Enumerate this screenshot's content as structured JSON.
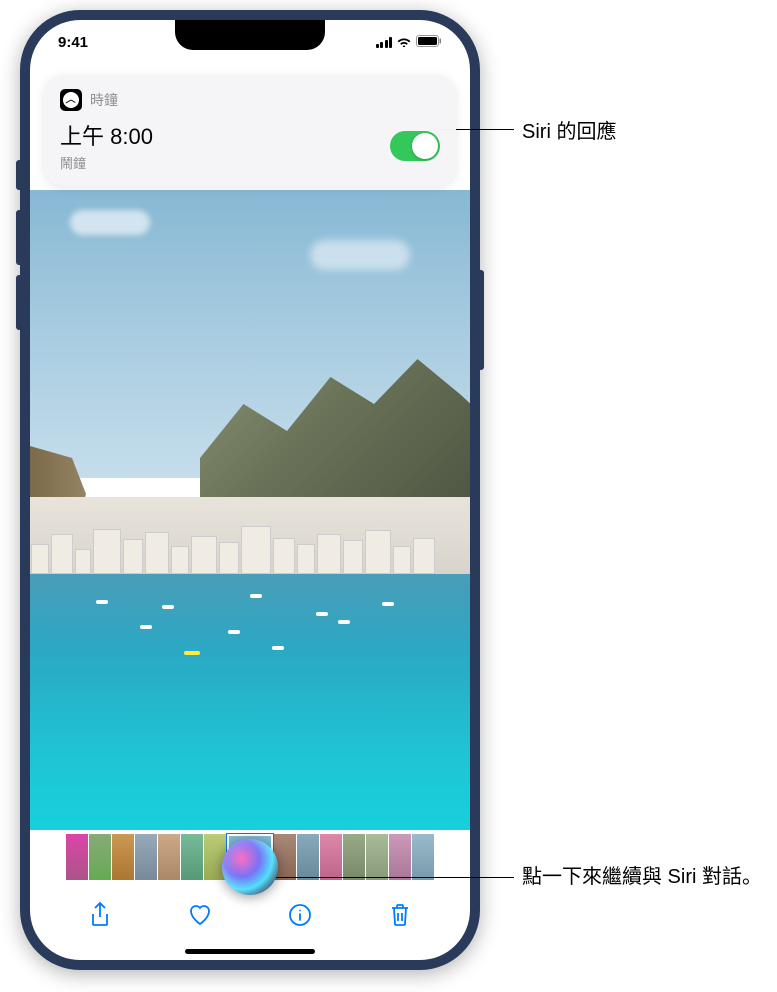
{
  "status": {
    "time": "9:41"
  },
  "siri_response": {
    "app_name": "時鐘",
    "alarm_time": "上午 8:00",
    "alarm_label": "鬧鐘",
    "toggle_on": true
  },
  "toolbar": {
    "share": "share-icon",
    "favorite": "heart-icon",
    "info": "info-icon",
    "delete": "trash-icon"
  },
  "callouts": {
    "siri_response_label": "Siri 的回應",
    "siri_orb_label": "點一下來繼續與 Siri 對話。"
  }
}
